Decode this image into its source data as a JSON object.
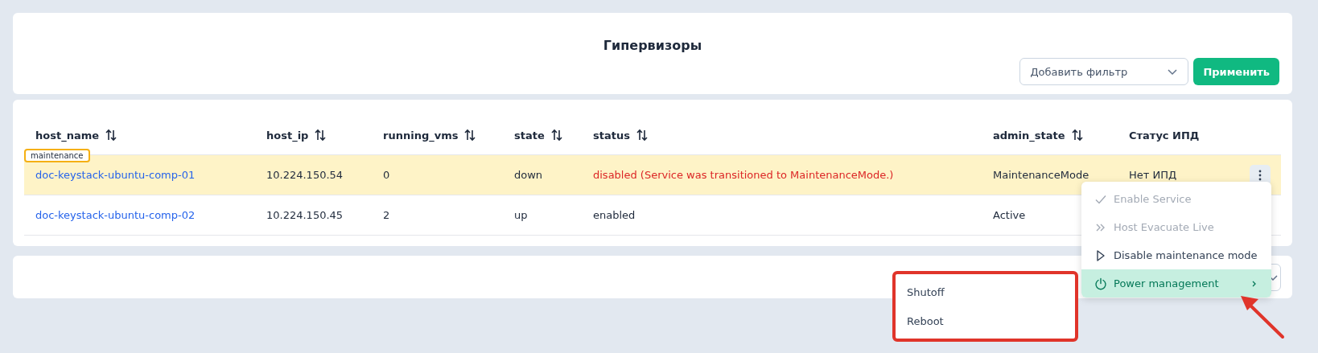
{
  "header": {
    "title": "Гипервизоры",
    "filter": {
      "placeholder": "Добавить фильтр"
    },
    "apply_button": "Применить"
  },
  "table": {
    "columns": [
      {
        "label": "host_name",
        "sortable": true
      },
      {
        "label": "host_ip",
        "sortable": true
      },
      {
        "label": "running_vms",
        "sortable": true
      },
      {
        "label": "state",
        "sortable": true
      },
      {
        "label": "status",
        "sortable": true
      },
      {
        "label": "admin_state",
        "sortable": true
      },
      {
        "label": "Статус ИПД",
        "sortable": false
      }
    ],
    "rows": [
      {
        "badge": "maintenance",
        "highlighted": true,
        "host_name": "doc-keystack-ubuntu-comp-01",
        "host_ip": "10.224.150.54",
        "running_vms": "0",
        "state": "down",
        "status": "disabled (Service was transitioned to MaintenanceMode.)",
        "status_error": true,
        "admin_state": "MaintenanceMode",
        "ipd_status": "Нет ИПД",
        "menu_open": true
      },
      {
        "highlighted": false,
        "host_name": "doc-keystack-ubuntu-comp-02",
        "host_ip": "10.224.150.45",
        "running_vms": "2",
        "state": "up",
        "status": "enabled",
        "status_error": false,
        "admin_state": "Active"
      }
    ]
  },
  "row_menu": {
    "items": [
      {
        "kind": "check",
        "label": "Enable Service",
        "disabled": true,
        "selected": false,
        "submenu": false
      },
      {
        "kind": "double-chevron",
        "label": "Host Evacuate Live",
        "disabled": true,
        "selected": false,
        "submenu": false
      },
      {
        "kind": "play",
        "label": "Disable maintenance mode",
        "disabled": false,
        "selected": false,
        "submenu": false
      },
      {
        "kind": "power",
        "label": "Power management",
        "disabled": false,
        "selected": true,
        "submenu": true
      }
    ]
  },
  "submenu": {
    "highlighted": true,
    "items": [
      {
        "label": "Shutoff"
      },
      {
        "label": "Reboot"
      }
    ]
  }
}
